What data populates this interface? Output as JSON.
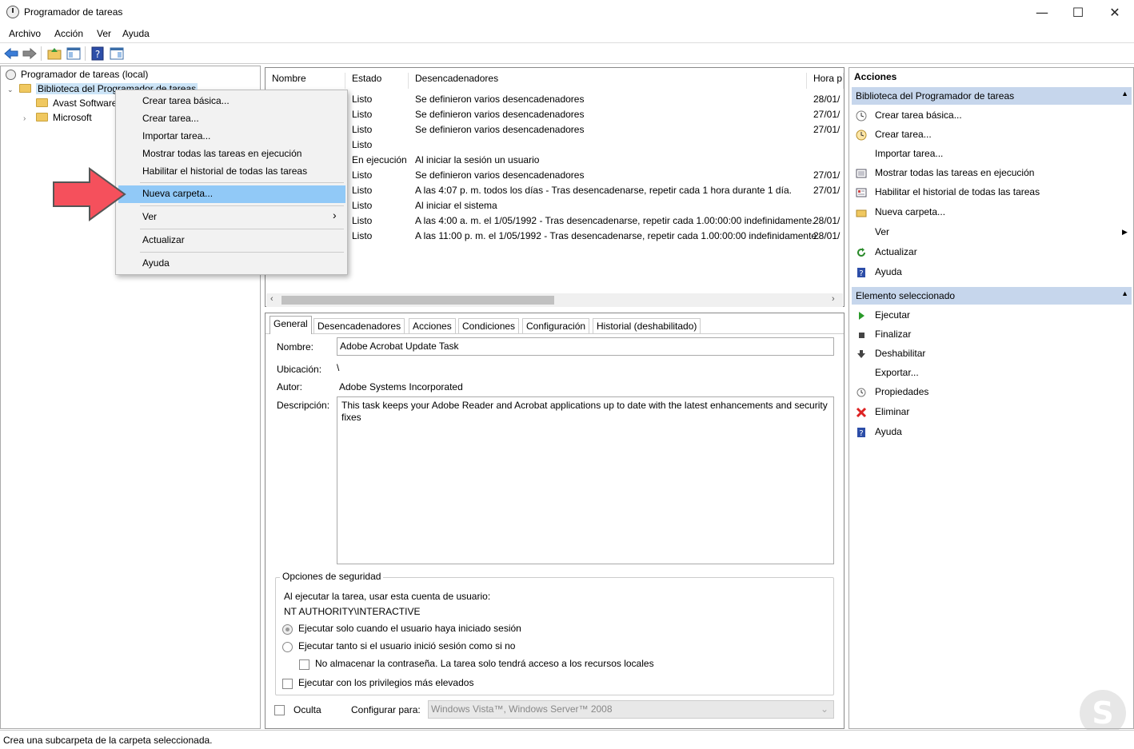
{
  "window": {
    "title": "Programador de tareas",
    "minimize": "—",
    "maximize": "☐",
    "close": "✕"
  },
  "menubar": [
    "Archivo",
    "Acción",
    "Ver",
    "Ayuda"
  ],
  "tree": {
    "root": "Programador de tareas (local)",
    "library": "Biblioteca del Programador de tareas",
    "children": [
      "Avast Software",
      "Microsoft"
    ]
  },
  "context_menu": {
    "items": [
      "Crear tarea básica...",
      "Crear tarea...",
      "Importar tarea...",
      "Mostrar todas las tareas en ejecución",
      "Habilitar el historial de todas las tareas",
      "Nueva carpeta...",
      "Ver",
      "Actualizar",
      "Ayuda"
    ],
    "highlighted": "Nueva carpeta..."
  },
  "task_table": {
    "columns": [
      "Nombre",
      "Estado",
      "Desencadenadores",
      "Hora p"
    ],
    "rows": [
      {
        "estado": "Listo",
        "trigger": "Se definieron varios desencadenadores",
        "hora": "28/01/"
      },
      {
        "estado": "Listo",
        "trigger": "Se definieron varios desencadenadores",
        "hora": "27/01/"
      },
      {
        "estado": "Listo",
        "trigger": "Se definieron varios desencadenadores",
        "hora": "27/01/"
      },
      {
        "estado": "Listo",
        "trigger": "",
        "hora": ""
      },
      {
        "estado": "En ejecución",
        "trigger": "Al iniciar la sesión un usuario",
        "hora": ""
      },
      {
        "estado": "Listo",
        "trigger": "Se definieron varios desencadenadores",
        "hora": "27/01/"
      },
      {
        "estado": "Listo",
        "trigger": "A las 4:07 p. m. todos los días - Tras desencadenarse, repetir cada 1 hora durante 1 día.",
        "hora": "27/01/"
      },
      {
        "estado": "Listo",
        "trigger": "Al iniciar el sistema",
        "hora": ""
      },
      {
        "estado": "Listo",
        "trigger": "A las 4:00 a. m. el 1/05/1992 - Tras desencadenarse, repetir cada 1.00:00:00 indefinidamente.",
        "hora": "28/01/"
      },
      {
        "estado": "Listo",
        "trigger": "A las 11:00 p. m. el 1/05/1992 - Tras desencadenarse, repetir cada 1.00:00:00 indefinidamente.",
        "hora": "28/01/"
      }
    ]
  },
  "tabs": [
    "General",
    "Desencadenadores",
    "Acciones",
    "Condiciones",
    "Configuración",
    "Historial (deshabilitado)"
  ],
  "general": {
    "nombre_label": "Nombre:",
    "nombre": "Adobe Acrobat Update Task",
    "ubicacion_label": "Ubicación:",
    "ubicacion": "\\",
    "autor_label": "Autor:",
    "autor": "Adobe Systems Incorporated",
    "descripcion_label": "Descripción:",
    "descripcion": "This task keeps your Adobe Reader and Acrobat applications up to date with the latest enhancements and security fixes",
    "security_title": "Opciones de seguridad",
    "run_as_label": "Al ejecutar la tarea, usar esta cuenta de usuario:",
    "run_as_user": "NT AUTHORITY\\INTERACTIVE",
    "radio1": "Ejecutar solo cuando el usuario haya iniciado sesión",
    "radio2": "Ejecutar tanto si el usuario inició sesión como si no",
    "no_password": "No almacenar la contraseña. La tarea solo tendrá acceso a los recursos locales",
    "highest_priv": "Ejecutar con los privilegios más elevados",
    "hidden": "Oculta",
    "configure_label": "Configurar para:",
    "configure_value": "Windows Vista™, Windows Server™ 2008"
  },
  "actions_pane": {
    "title": "Acciones",
    "section1": "Biblioteca del Programador de tareas",
    "section1_items": [
      "Crear tarea básica...",
      "Crear tarea...",
      "Importar tarea...",
      "Mostrar todas las tareas en ejecución",
      "Habilitar el historial de todas las tareas",
      "Nueva carpeta...",
      "Ver",
      "Actualizar",
      "Ayuda"
    ],
    "section2": "Elemento seleccionado",
    "section2_items": [
      "Ejecutar",
      "Finalizar",
      "Deshabilitar",
      "Exportar...",
      "Propiedades",
      "Eliminar",
      "Ayuda"
    ]
  },
  "status": "Crea una subcarpeta de la carpeta seleccionada."
}
